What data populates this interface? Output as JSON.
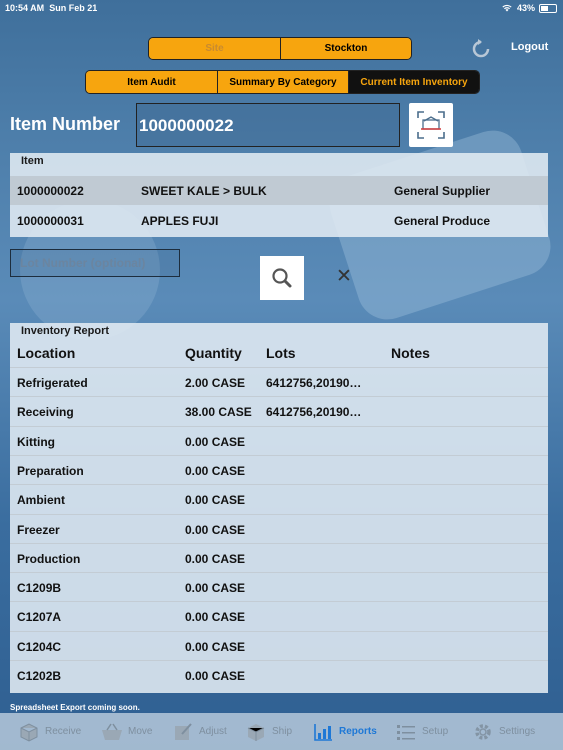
{
  "status_bar": {
    "time": "10:54 AM",
    "date": "Sun Feb 21",
    "battery": "43%"
  },
  "site_selector": {
    "site_label": "Site",
    "location": "Stockton"
  },
  "tabs": [
    "Item Audit",
    "Summary By Category",
    "Current Item Inventory"
  ],
  "header": {
    "logout_label": "Logout"
  },
  "item_search": {
    "label": "Item Number",
    "value": "1000000022"
  },
  "item_list": {
    "header": "Item",
    "rows": [
      {
        "number": "1000000022",
        "name": "SWEET KALE > BULK",
        "supplier": "General Supplier"
      },
      {
        "number": "1000000031",
        "name": "APPLES FUJI",
        "supplier": "General Produce"
      }
    ]
  },
  "lot_filter": {
    "placeholder": "Lot Number (optional)"
  },
  "report": {
    "title": "Inventory Report",
    "columns": {
      "location": "Location",
      "quantity": "Quantity",
      "lots": "Lots",
      "notes": "Notes"
    },
    "rows": [
      {
        "location": "Refrigerated",
        "quantity": "2.00 CASE",
        "lots": "6412756,20190…",
        "notes": ""
      },
      {
        "location": "Receiving",
        "quantity": "38.00 CASE",
        "lots": "6412756,20190…",
        "notes": ""
      },
      {
        "location": "Kitting",
        "quantity": "0.00 CASE",
        "lots": "",
        "notes": ""
      },
      {
        "location": "Preparation",
        "quantity": "0.00 CASE",
        "lots": "",
        "notes": ""
      },
      {
        "location": "Ambient",
        "quantity": "0.00 CASE",
        "lots": "",
        "notes": ""
      },
      {
        "location": "Freezer",
        "quantity": "0.00 CASE",
        "lots": "",
        "notes": ""
      },
      {
        "location": "Production",
        "quantity": "0.00 CASE",
        "lots": "",
        "notes": ""
      },
      {
        "location": "C1209B",
        "quantity": "0.00 CASE",
        "lots": "",
        "notes": ""
      },
      {
        "location": "C1207A",
        "quantity": "0.00 CASE",
        "lots": "",
        "notes": ""
      },
      {
        "location": "C1204C",
        "quantity": "0.00 CASE",
        "lots": "",
        "notes": ""
      },
      {
        "location": "C1202B",
        "quantity": "0.00 CASE",
        "lots": "",
        "notes": ""
      }
    ]
  },
  "footer_note": "Spreadsheet Export coming soon.",
  "tab_bar": [
    {
      "label": "Receive",
      "icon": "box-icon"
    },
    {
      "label": "Move",
      "icon": "basket-icon"
    },
    {
      "label": "Adjust",
      "icon": "edit-icon"
    },
    {
      "label": "Ship",
      "icon": "package-icon"
    },
    {
      "label": "Reports",
      "icon": "chart-icon",
      "active": true
    },
    {
      "label": "Setup",
      "icon": "list-icon"
    },
    {
      "label": "Settings",
      "icon": "gear-icon"
    }
  ],
  "colors": {
    "accent": "#f7a50e",
    "active_tab": "#1e78d6",
    "background": "#4d7eaa"
  }
}
